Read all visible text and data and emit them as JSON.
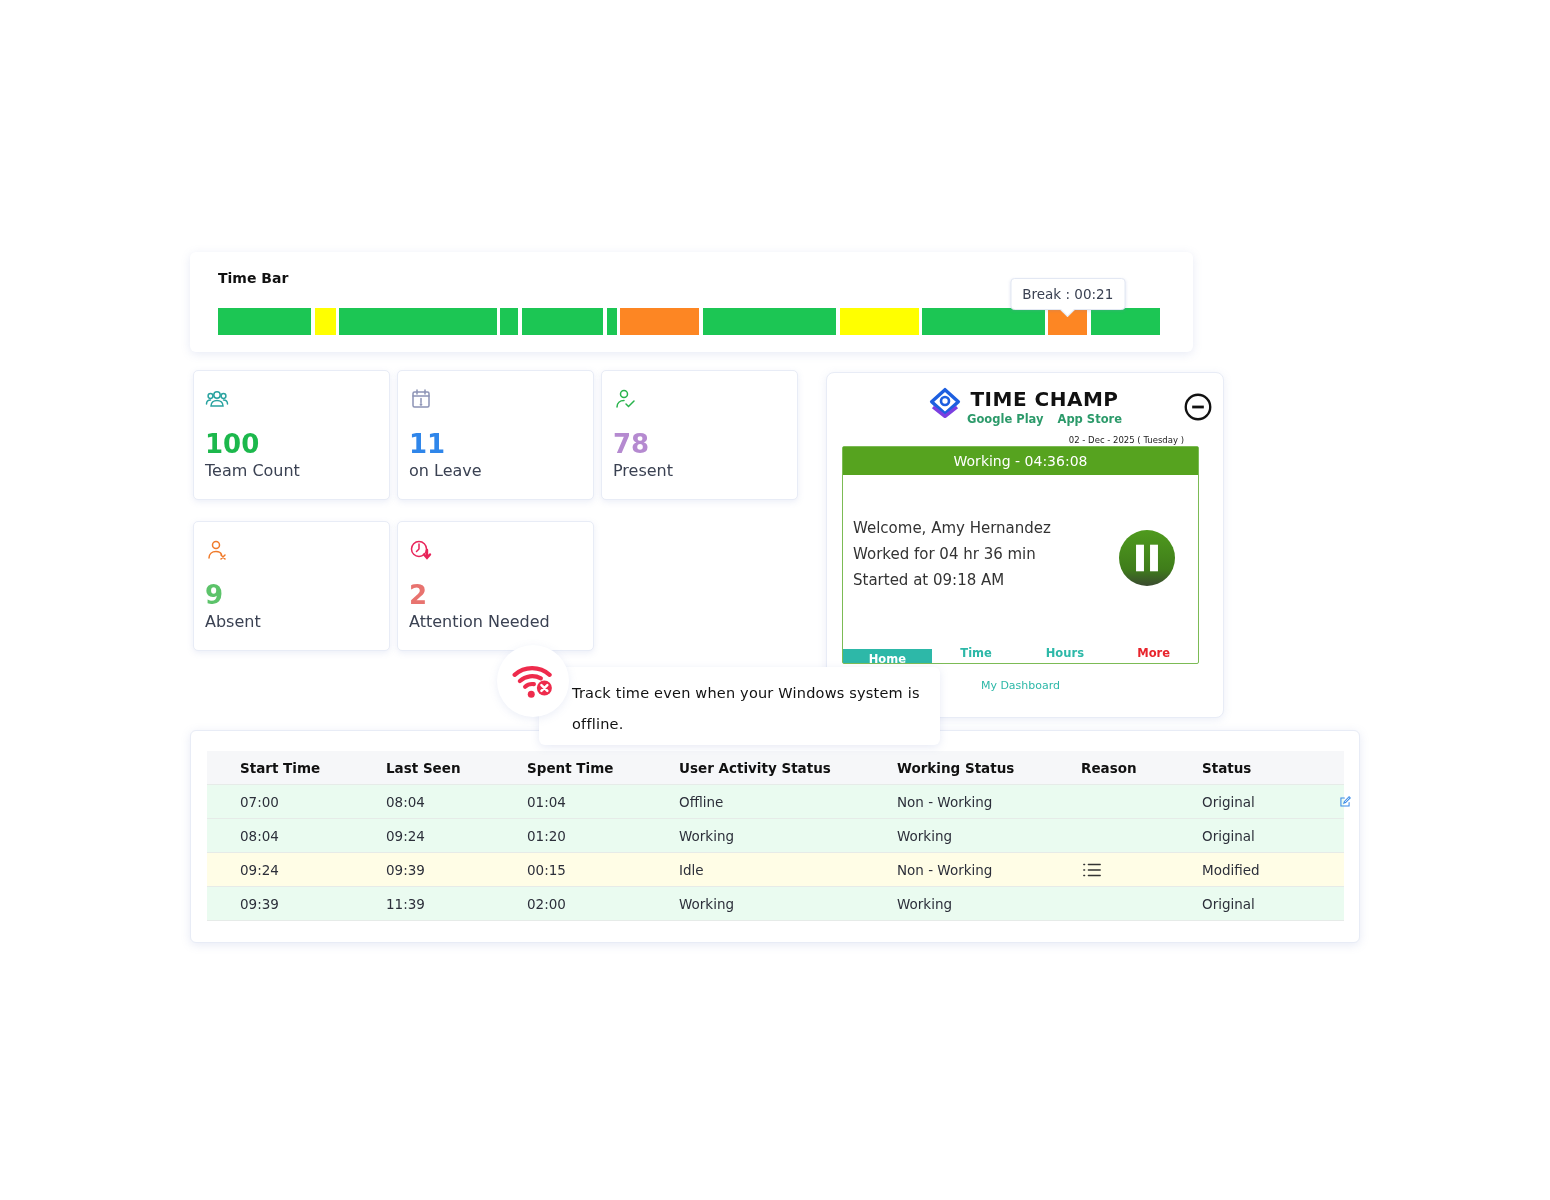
{
  "time_bar": {
    "title": "Time Bar",
    "segments": [
      {
        "color": "#1cc654"
      },
      {
        "color": "#ffff00"
      },
      {
        "color": "#1cc654"
      },
      {
        "color": "#1cc654"
      },
      {
        "color": "#1cc654"
      },
      {
        "color": "#1cc654"
      },
      {
        "color": "#fd8623"
      },
      {
        "color": "#1cc654"
      },
      {
        "color": "#ffff00"
      },
      {
        "color": "#1cc654"
      },
      {
        "color": "#fd8623",
        "tooltip": "Break : 00:21"
      },
      {
        "color": "#1cc654"
      }
    ]
  },
  "stats": [
    {
      "kind": "team",
      "value": "100",
      "label": "Team Count",
      "color": "#1cb84c"
    },
    {
      "kind": "leave",
      "value": "11",
      "label": "on Leave",
      "color": "#2f86ea"
    },
    {
      "kind": "present",
      "value": "78",
      "label": "Present",
      "color": "#b58ad0"
    },
    {
      "kind": "absent",
      "value": "9",
      "label": "Absent",
      "color": "#5cc36a"
    },
    {
      "kind": "attention",
      "value": "2",
      "label": "Attention Needed",
      "color": "#e8736f"
    }
  ],
  "app": {
    "logo": "TIME CHAMP",
    "store_links": [
      "Google Play",
      "App Store"
    ],
    "date": "02 - Dec - 2025 ( Tuesday )",
    "status": "Working - 04:36:08",
    "lines": [
      "Welcome, Amy Hernandez",
      "Worked for 04 hr 36 min",
      "Started at 09:18 AM"
    ],
    "tabs": [
      {
        "label": "Home",
        "selected": true,
        "color": "#2db8a8"
      },
      {
        "label": "Time",
        "selected": false,
        "color": "#2db8a8"
      },
      {
        "label": "Hours",
        "selected": false,
        "color": "#2db8a8"
      },
      {
        "label": "More",
        "selected": false,
        "color": "#e8242c"
      }
    ],
    "dashboard_link": "My Dashboard"
  },
  "callout": {
    "text": "Track time even when your Windows system is offline."
  },
  "table": {
    "columns": [
      "Start Time",
      "Last Seen",
      "Spent Time",
      "User Activity Status",
      "Working Status",
      "Reason",
      "Status"
    ],
    "rows": [
      {
        "cells": [
          "07:00",
          "08:04",
          "01:04",
          "Offline",
          "Non - Working",
          "",
          "Original"
        ],
        "highlighted": false,
        "reason_icon": false,
        "edit_icon": true
      },
      {
        "cells": [
          "08:04",
          "09:24",
          "01:20",
          "Working",
          "Working",
          "",
          "Original"
        ],
        "highlighted": false,
        "reason_icon": false,
        "edit_icon": false
      },
      {
        "cells": [
          "09:24",
          "09:39",
          "00:15",
          "Idle",
          "Non - Working",
          "",
          "Modified"
        ],
        "highlighted": true,
        "reason_icon": true,
        "edit_icon": false
      },
      {
        "cells": [
          "09:39",
          "11:39",
          "02:00",
          "Working",
          "Working",
          "",
          "Original"
        ],
        "highlighted": false,
        "reason_icon": false,
        "edit_icon": false
      }
    ]
  }
}
